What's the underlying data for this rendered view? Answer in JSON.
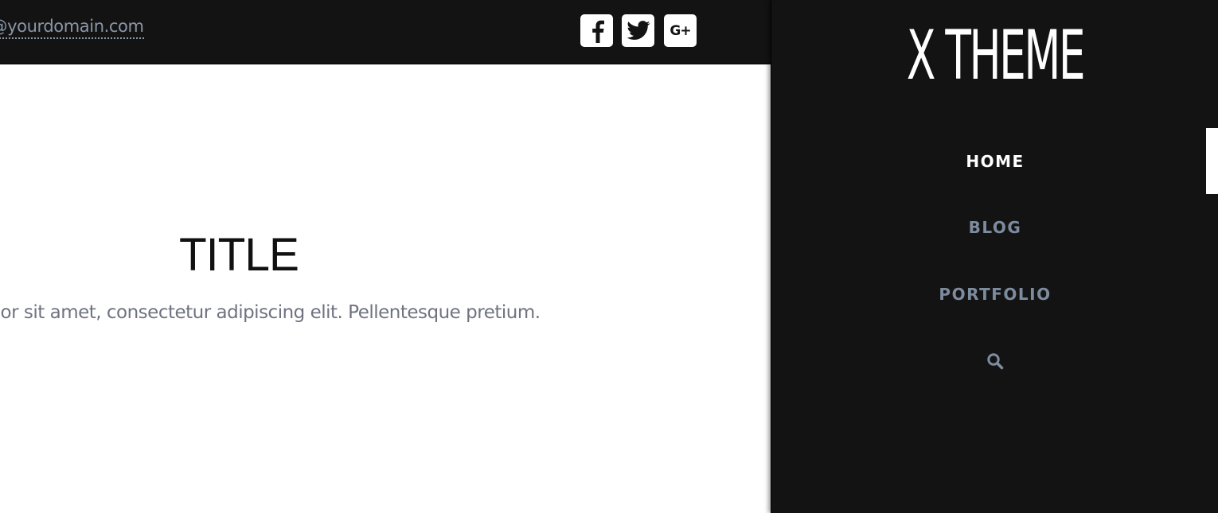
{
  "topbar": {
    "email": "e@yourdomain.com",
    "social": [
      {
        "name": "facebook",
        "icon": "facebook-icon"
      },
      {
        "name": "twitter",
        "icon": "twitter-icon"
      },
      {
        "name": "google-plus",
        "icon": "google-plus-icon",
        "glyph": "G+"
      }
    ]
  },
  "main": {
    "title": "TITLE",
    "subtitle": "dolor sit amet, consectetur adipiscing elit. Pellentesque pretium."
  },
  "sidebar": {
    "logo": "X THEME",
    "nav": [
      {
        "label": "HOME",
        "active": true
      },
      {
        "label": "BLOG",
        "active": false
      },
      {
        "label": "PORTFOLIO",
        "active": false
      }
    ],
    "search_icon": "search-icon"
  },
  "colors": {
    "dark_bg": "#131313",
    "nav_inactive": "#7d8b9e",
    "nav_active": "#ffffff",
    "link": "#8a96a8",
    "subtitle": "#6f7380"
  }
}
